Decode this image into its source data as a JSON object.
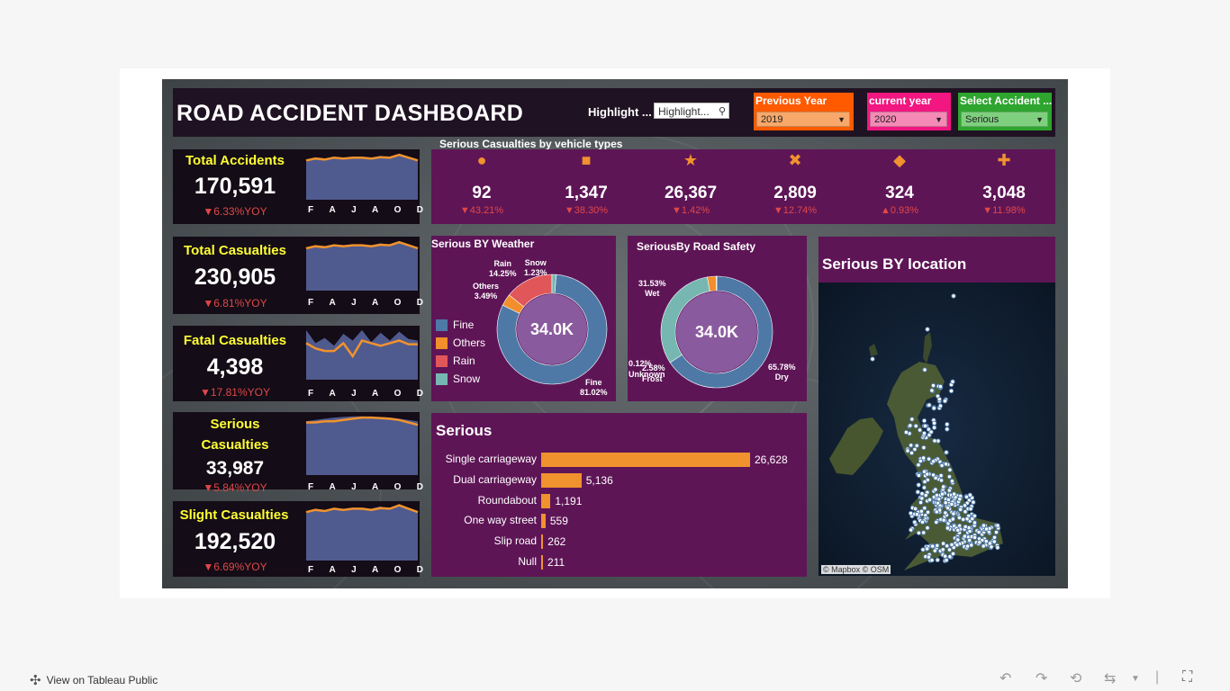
{
  "dashboard": {
    "title": "ROAD ACCIDENT DASHBOARD",
    "highlight_label": "Highlight ...",
    "highlight_placeholder": "Highlight...",
    "filters": [
      {
        "label": "Previous Year",
        "value": "2019",
        "color": "#ff5a00",
        "sel_color": "#f7a86a"
      },
      {
        "label": "current year",
        "value": "2020",
        "color": "#f21680",
        "sel_color": "#f48ab5"
      },
      {
        "label": "Select Accident ...",
        "value": "Serious",
        "color": "#2ea52e",
        "sel_color": "#7ed07e"
      }
    ]
  },
  "kpis": [
    {
      "title": "Total Accidents",
      "value": "170,591",
      "yoy": "▼6.33%YOY"
    },
    {
      "title": "Total Casualties",
      "value": "230,905",
      "yoy": "▼6.81%YOY"
    },
    {
      "title": "Fatal Casualties",
      "value": "4,398",
      "yoy": "▼17.81%YOY"
    },
    {
      "title": "Serious Casualties",
      "value": "33,987",
      "yoy": "▼5.84%YOY"
    },
    {
      "title": "Slight Casualties",
      "value": "192,520",
      "yoy": "▼6.69%YOY"
    }
  ],
  "month_ticks": [
    "F",
    "A",
    "J",
    "A",
    "O",
    "D"
  ],
  "vehicle_types": {
    "title": "Serious Casualties by vehicle types",
    "items": [
      {
        "icon": "●",
        "value": "92",
        "yoy": "▼43.21%"
      },
      {
        "icon": "■",
        "value": "1,347",
        "yoy": "▼38.30%"
      },
      {
        "icon": "★",
        "value": "26,367",
        "yoy": "▼1.42%"
      },
      {
        "icon": "✖",
        "value": "2,809",
        "yoy": "▼12.74%"
      },
      {
        "icon": "◆",
        "value": "324",
        "yoy": "▲0.93%"
      },
      {
        "icon": "✚",
        "value": "3,048",
        "yoy": "▼11.98%"
      }
    ]
  },
  "weather": {
    "title": "Serious BY Weather",
    "center": "34.0K",
    "legend": [
      {
        "name": "Fine",
        "color": "#4e79a7"
      },
      {
        "name": "Others",
        "color": "#f28e2b"
      },
      {
        "name": "Rain",
        "color": "#e15759"
      },
      {
        "name": "Snow",
        "color": "#76b7b2"
      }
    ],
    "labels": {
      "fine": [
        "Fine",
        "81.02%"
      ],
      "others": [
        "Others",
        "3.49%"
      ],
      "rain": [
        "Rain",
        "14.25%"
      ],
      "snow": [
        "Snow",
        "1.23%"
      ]
    }
  },
  "road_safety": {
    "title": "SeriousBy Road Safety",
    "center": "34.0K",
    "labels": {
      "wet": [
        "31.53%",
        "Wet"
      ],
      "dry": [
        "65.78%",
        "Dry"
      ],
      "unknown": [
        "0.12%",
        "Unknown"
      ],
      "frost": [
        "2.58%",
        "Frost"
      ]
    }
  },
  "serious_bars": {
    "title": "Serious",
    "rows": [
      {
        "label": "Single carriageway",
        "value": "26,628"
      },
      {
        "label": "Dual carriageway",
        "value": "5,136"
      },
      {
        "label": "Roundabout",
        "value": "1,191"
      },
      {
        "label": "One way street",
        "value": "559"
      },
      {
        "label": "Slip road",
        "value": "262"
      },
      {
        "label": "Null",
        "value": "211"
      }
    ]
  },
  "chart_data": [
    {
      "type": "pie",
      "title": "Serious BY Weather",
      "categories": [
        "Fine",
        "Others",
        "Rain",
        "Snow"
      ],
      "values": [
        81.02,
        3.49,
        14.25,
        1.23
      ]
    },
    {
      "type": "pie",
      "title": "SeriousBy Road Safety",
      "categories": [
        "Dry",
        "Wet",
        "Frost",
        "Unknown"
      ],
      "values": [
        65.78,
        31.53,
        2.58,
        0.12
      ]
    },
    {
      "type": "bar",
      "title": "Serious",
      "categories": [
        "Single carriageway",
        "Dual carriageway",
        "Roundabout",
        "One way street",
        "Slip road",
        "Null"
      ],
      "values": [
        26628,
        5136,
        1191,
        559,
        262,
        211
      ]
    }
  ],
  "map": {
    "title": "Serious BY location",
    "attribution": "© Mapbox  © OSM"
  },
  "footer": {
    "link": "View on Tableau Public"
  }
}
